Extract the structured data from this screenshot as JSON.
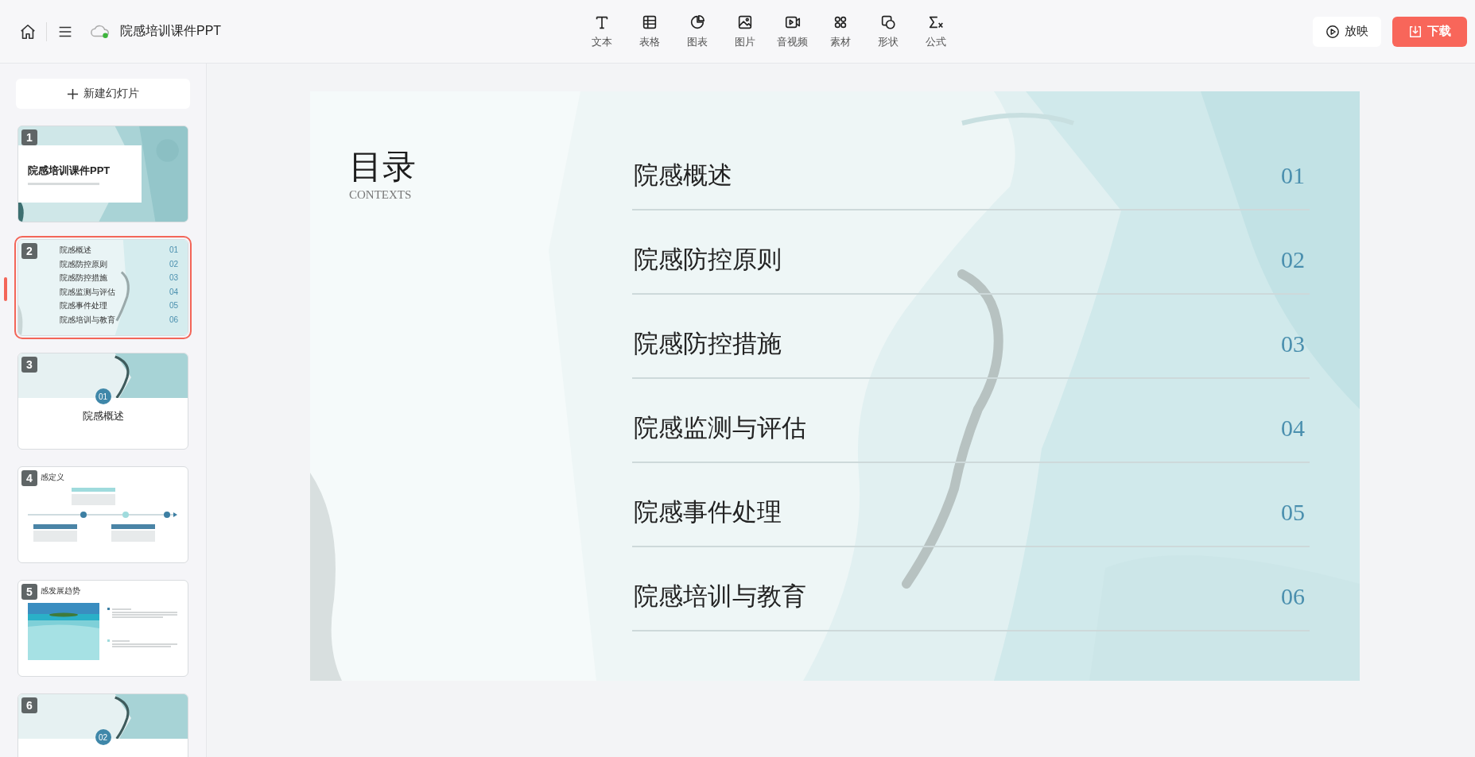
{
  "toolbar": {
    "title": "院感培训课件PPT",
    "tools": [
      {
        "label": "文本"
      },
      {
        "label": "表格"
      },
      {
        "label": "图表"
      },
      {
        "label": "图片"
      },
      {
        "label": "音视频"
      },
      {
        "label": "素材"
      },
      {
        "label": "形状"
      },
      {
        "label": "公式"
      }
    ],
    "buttons": [
      {
        "label": "放映",
        "kind": "play"
      },
      {
        "label": "下载",
        "kind": "download"
      }
    ]
  },
  "sidebar": {
    "new_slide_button": "新建幻灯片",
    "slides": [
      {
        "number": "1",
        "selected": false,
        "kind": "cover",
        "title": "院感培训课件PPT"
      },
      {
        "number": "2",
        "selected": true,
        "kind": "contents",
        "items": [
          {
            "label": "院感概述",
            "number": "01"
          },
          {
            "label": "院感防控原则",
            "number": "02"
          },
          {
            "label": "院感防控措施",
            "number": "03"
          },
          {
            "label": "院感监测与评估",
            "number": "04"
          },
          {
            "label": "院感事件处理",
            "number": "05"
          },
          {
            "label": "院感培训与教育",
            "number": "06"
          }
        ]
      },
      {
        "number": "3",
        "selected": false,
        "kind": "section",
        "badge": "01",
        "title": "院感概述"
      },
      {
        "number": "4",
        "selected": false,
        "kind": "timeline",
        "title": "感定义"
      },
      {
        "number": "5",
        "selected": false,
        "title": "感发展趋势"
      },
      {
        "number": "6",
        "selected": false,
        "kind": "section",
        "badge": "02"
      }
    ]
  },
  "slide": {
    "heading": "目录",
    "subheading": "CONTEXTS",
    "items": [
      {
        "label": "院感概述",
        "number": "01"
      },
      {
        "label": "院感防控原则",
        "number": "02"
      },
      {
        "label": "院感防控措施",
        "number": "03"
      },
      {
        "label": "院感监测与评估",
        "number": "04"
      },
      {
        "label": "院感事件处理",
        "number": "05"
      },
      {
        "label": "院感培训与教育",
        "number": "06"
      }
    ]
  }
}
